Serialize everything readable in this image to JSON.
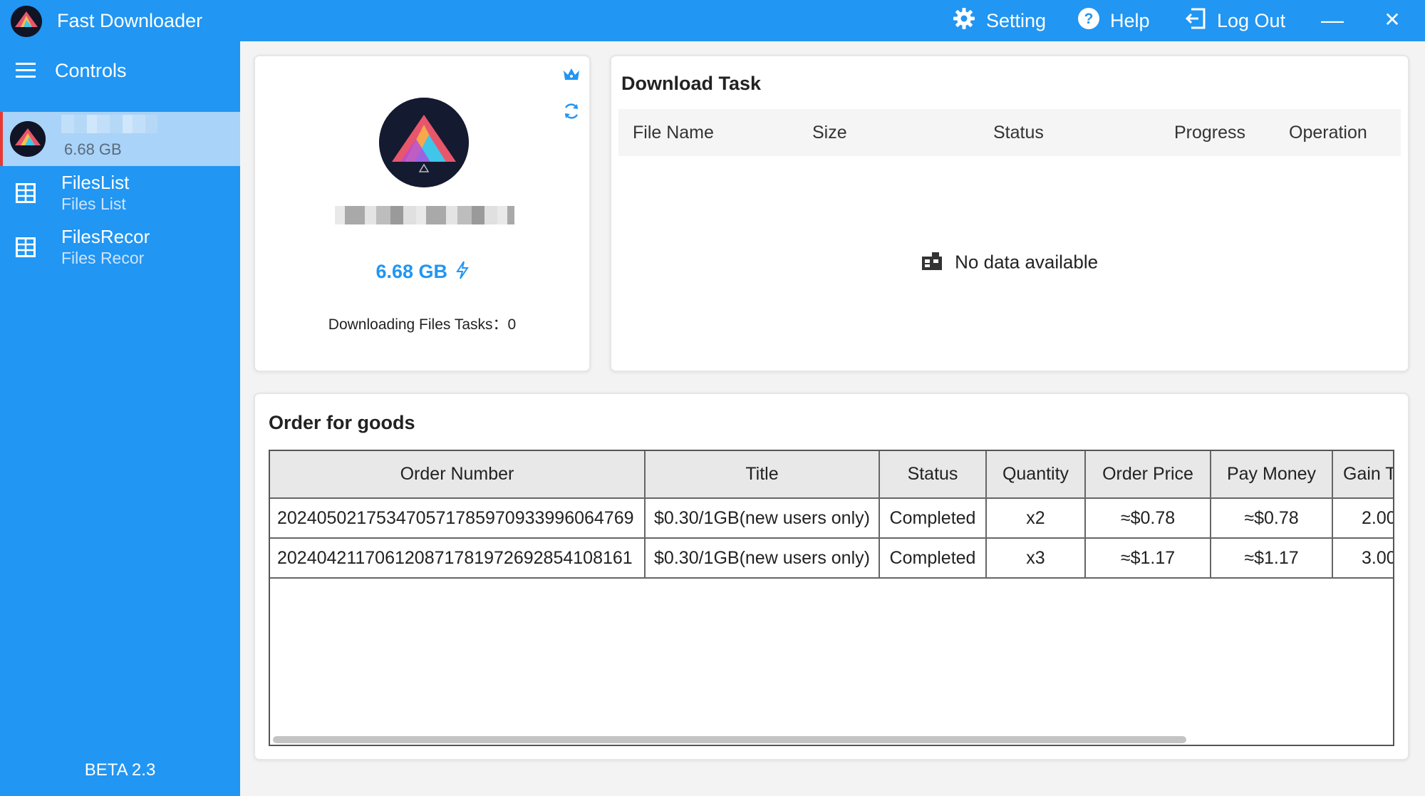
{
  "app": {
    "title": "Fast Downloader"
  },
  "titlebar": {
    "setting_label": "Setting",
    "help_label": "Help",
    "logout_label": "Log Out",
    "minimize": "—",
    "close": "✕"
  },
  "sidebar": {
    "controls_label": "Controls",
    "account": {
      "size": "6.68 GB"
    },
    "items": [
      {
        "title": "FilesList",
        "subtitle": "Files List",
        "icon": "table-icon"
      },
      {
        "title": "FilesRecor",
        "subtitle": "Files Recor",
        "icon": "table-icon"
      }
    ],
    "version": "BETA 2.3"
  },
  "profile": {
    "quota": "6.68 GB",
    "downloading_tasks": "Downloading Files Tasks：0",
    "icons": [
      "crown-icon",
      "refresh-icon",
      "bolt-icon"
    ]
  },
  "download_task": {
    "title": "Download Task",
    "columns": [
      "File Name",
      "Size",
      "Status",
      "Progress",
      "Operation"
    ],
    "empty_text": "No data available"
  },
  "orders": {
    "title": "Order for goods",
    "columns": [
      "Order Number",
      "Title",
      "Status",
      "Quantity",
      "Order Price",
      "Pay Money",
      "Gain T"
    ],
    "rows": [
      [
        "20240502175347057178597093399606 4769",
        "$0.30/1GB(new users only)",
        "Completed",
        "x2",
        "≈$0.78",
        "≈$0.78",
        "2.00"
      ],
      [
        "202404211706120871781972692854108161",
        "$0.30/1GB(new users only)",
        "Completed",
        "x3",
        "≈$1.17",
        "≈$1.17",
        "3.00"
      ]
    ]
  },
  "colors": {
    "primary": "#2196f3",
    "active_item": "#a9d3f8",
    "active_marker": "#e53935"
  }
}
